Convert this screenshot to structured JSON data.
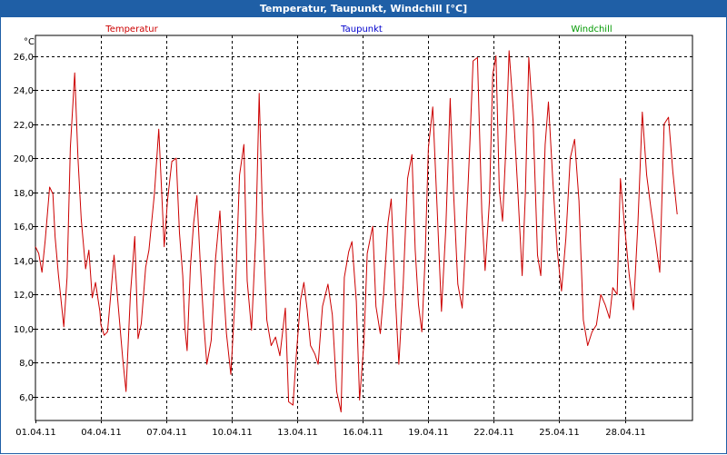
{
  "window": {
    "title": "Temperatur, Taupunkt, Windchill [°C]"
  },
  "colors": {
    "titlebar": "#1f5fa6",
    "temperature": "#cc0000",
    "dewpoint": "#0000cc",
    "windchill": "#009900"
  },
  "chart_data": {
    "type": "line",
    "title": "Temperatur, Taupunkt, Windchill [°C]",
    "unit_label": "°C",
    "legend": [
      {
        "name": "Temperatur",
        "color": "#cc0000"
      },
      {
        "name": "Taupunkt",
        "color": "#0000cc"
      },
      {
        "name": "Windchill",
        "color": "#009900"
      }
    ],
    "x_tick_labels": [
      "01.04.11",
      "04.04.11",
      "07.04.11",
      "10.04.11",
      "13.04.11",
      "16.04.11",
      "19.04.11",
      "22.04.11",
      "25.04.11",
      "28.04.11"
    ],
    "x_tick_days": [
      0,
      3,
      6,
      9,
      12,
      15,
      18,
      21,
      24,
      27
    ],
    "xlim_days": [
      0,
      30.1
    ],
    "y_ticks": [
      6.0,
      8.0,
      10.0,
      12.0,
      14.0,
      16.0,
      18.0,
      20.0,
      22.0,
      24.0,
      26.0
    ],
    "y_tick_labels": [
      "6,0",
      "8,0",
      "10,0",
      "12,0",
      "14,0",
      "16,0",
      "18,0",
      "20,0",
      "22,0",
      "24,0",
      "26,0"
    ],
    "ylim": [
      4.6,
      27.2
    ],
    "grid": true,
    "series": [
      {
        "name": "Temperatur",
        "x_days": [
          0.0,
          0.15,
          0.3,
          0.45,
          0.65,
          0.8,
          0.9,
          1.05,
          1.3,
          1.45,
          1.6,
          1.8,
          1.95,
          2.1,
          2.3,
          2.45,
          2.6,
          2.75,
          2.95,
          3.0,
          3.15,
          3.3,
          3.45,
          3.6,
          3.8,
          4.0,
          4.15,
          4.35,
          4.55,
          4.7,
          4.85,
          5.05,
          5.2,
          5.45,
          5.65,
          5.9,
          6.05,
          6.25,
          6.45,
          6.6,
          6.75,
          6.85,
          6.95,
          7.1,
          7.25,
          7.4,
          7.55,
          7.7,
          7.85,
          8.05,
          8.25,
          8.45,
          8.6,
          8.75,
          8.95,
          9.15,
          9.35,
          9.55,
          9.7,
          9.9,
          10.1,
          10.25,
          10.4,
          10.6,
          10.8,
          11.0,
          11.2,
          11.45,
          11.6,
          11.8,
          11.95,
          12.15,
          12.3,
          12.45,
          12.6,
          12.8,
          12.95,
          13.15,
          13.4,
          13.6,
          13.8,
          14.0,
          14.15,
          14.35,
          14.5,
          14.7,
          14.85,
          15.05,
          15.2,
          15.45,
          15.6,
          15.8,
          15.95,
          16.15,
          16.3,
          16.5,
          16.65,
          16.85,
          17.05,
          17.25,
          17.4,
          17.55,
          17.7,
          17.85,
          18.0,
          18.2,
          18.4,
          18.6,
          18.8,
          19.0,
          19.15,
          19.35,
          19.55,
          19.7,
          19.9,
          20.05,
          20.25,
          20.45,
          20.6,
          20.8,
          20.95,
          21.1,
          21.25,
          21.4,
          21.55,
          21.7,
          21.9,
          22.1,
          22.3,
          22.45,
          22.6,
          22.8,
          23.0,
          23.15,
          23.35,
          23.5,
          23.7,
          23.9,
          24.1,
          24.3,
          24.5,
          24.7,
          24.9,
          25.1,
          25.3,
          25.5,
          25.7,
          25.9,
          26.1,
          26.3,
          26.45,
          26.65,
          26.8,
          27.0,
          27.2,
          27.4,
          27.6,
          27.8,
          28.0,
          28.2,
          28.4,
          28.6,
          28.8,
          29.0,
          29.2,
          29.4,
          29.6,
          29.8,
          30.0,
          30.1
        ],
        "values": [
          14.8,
          14.4,
          13.3,
          15.2,
          18.3,
          17.9,
          15.4,
          13.2,
          10.1,
          13.0,
          20.6,
          25.0,
          20.0,
          16.4,
          13.5,
          14.6,
          11.8,
          12.7,
          11.0,
          10.2,
          9.6,
          9.8,
          12.0,
          14.3,
          11.2,
          8.2,
          6.3,
          12.0,
          15.4,
          9.4,
          10.3,
          13.6,
          14.6,
          17.9,
          21.7,
          14.8,
          17.5,
          19.8,
          20.0,
          15.6,
          13.1,
          10.0,
          8.7,
          13.6,
          16.2,
          17.8,
          13.8,
          10.5,
          7.9,
          9.3,
          14.1,
          16.9,
          12.8,
          9.7,
          7.3,
          11.9,
          19.0,
          20.8,
          12.8,
          9.9,
          15.6,
          23.8,
          16.8,
          10.5,
          9.0,
          9.5,
          8.4,
          11.2,
          5.7,
          5.5,
          8.4,
          11.7,
          12.7,
          11.1,
          9.0,
          8.5,
          7.9,
          11.3,
          12.6,
          10.8,
          6.3,
          5.1,
          13.0,
          14.5,
          15.1,
          11.6,
          5.8,
          9.2,
          14.4,
          16.0,
          11.3,
          9.7,
          12.0,
          16.2,
          17.6,
          11.6,
          7.9,
          12.6,
          18.8,
          20.2,
          14.6,
          11.4,
          9.8,
          14.1,
          20.6,
          23.0,
          17.1,
          11.0,
          15.9,
          23.5,
          18.1,
          12.6,
          11.2,
          14.9,
          20.8,
          25.7,
          25.9,
          16.8,
          13.4,
          17.5,
          24.9,
          26.0,
          18.2,
          16.3,
          20.5,
          26.3,
          22.7,
          18.1,
          13.1,
          18.0,
          25.9,
          22.1,
          14.3,
          13.1,
          20.8,
          23.3,
          18.7,
          14.6,
          12.2,
          15.3,
          20.0,
          21.1,
          17.5,
          10.5,
          9.0,
          9.8,
          10.2,
          12.0,
          11.4,
          10.6,
          12.4,
          12.0,
          18.8,
          15.9,
          13.2,
          11.1,
          16.2,
          22.7,
          19.0,
          17.0,
          15.2,
          13.3,
          22.0,
          22.4,
          19.2,
          16.7
        ]
      }
    ]
  }
}
